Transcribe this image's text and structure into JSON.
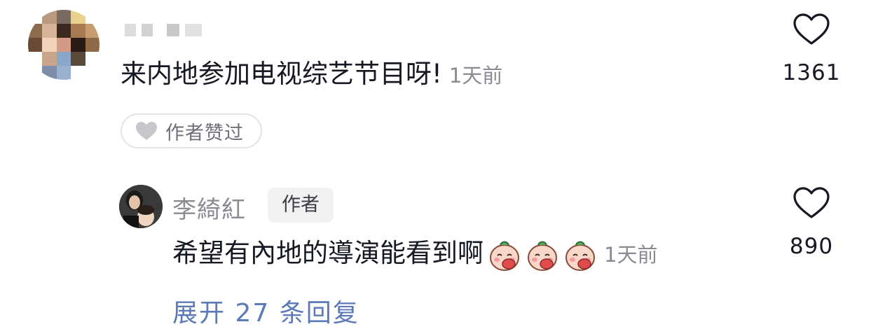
{
  "comments": [
    {
      "username_masked": true,
      "text": "来内地参加电视综艺节目呀!",
      "time": "1天前",
      "author_liked_label": "作者赞过",
      "like_count": "1361",
      "like_icon": "heart-outline-icon",
      "avatar_icon": "pixelated-avatar"
    },
    {
      "username": "李綺紅",
      "author_badge": "作者",
      "text": "希望有內地的導演能看到啊",
      "emoji_count": 3,
      "emoji_icon": "cover-mouth-emoji",
      "time": "1天前",
      "like_count": "890",
      "like_icon": "heart-outline-icon",
      "avatar_icon": "user-photo-avatar"
    }
  ],
  "replies": {
    "expand_label": "展开 27 条回复"
  },
  "colors": {
    "text_primary": "#161823",
    "text_secondary": "#8a8b91",
    "link": "#5b7ab7",
    "chip_border": "#e3e3e5",
    "badge_bg": "#f1f1f2"
  }
}
